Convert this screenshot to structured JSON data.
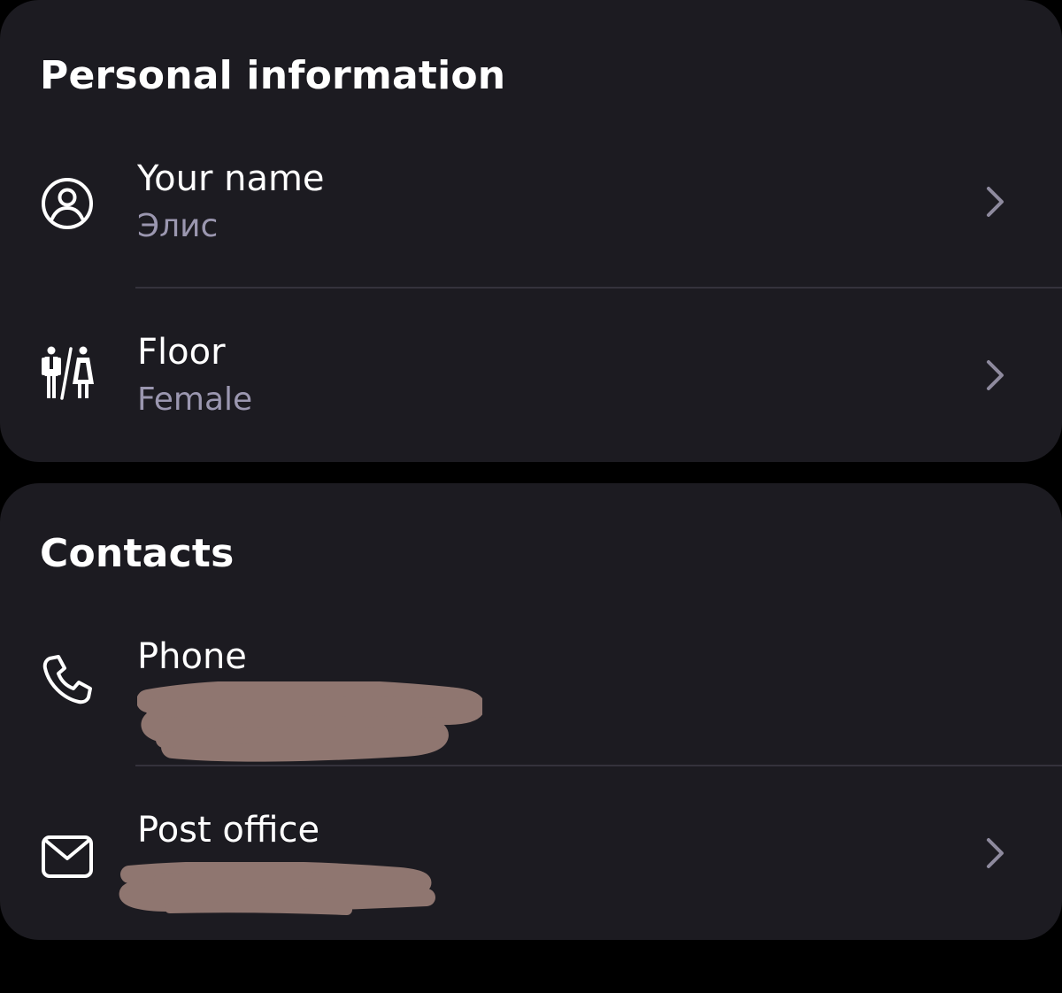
{
  "colors": {
    "background": "#000000",
    "card": "#1c1b21",
    "primary_text": "#ffffff",
    "secondary_text": "#9b97b0",
    "divider": "#34323c",
    "chevron": "#8e8a9e",
    "redaction": "#8f7670"
  },
  "personal_info": {
    "title": "Personal information",
    "items": [
      {
        "label": "Your name",
        "value": "Элис",
        "icon": "person-circle-icon",
        "has_chevron": true
      },
      {
        "label": "Floor",
        "value": "Female",
        "icon": "gender-icon",
        "has_chevron": true
      }
    ]
  },
  "contacts": {
    "title": "Contacts",
    "items": [
      {
        "label": "Phone",
        "value": "",
        "value_redacted": true,
        "icon": "phone-icon",
        "has_chevron": false
      },
      {
        "label": "Post office",
        "value": "",
        "value_redacted": true,
        "icon": "mail-icon",
        "has_chevron": true
      }
    ]
  }
}
